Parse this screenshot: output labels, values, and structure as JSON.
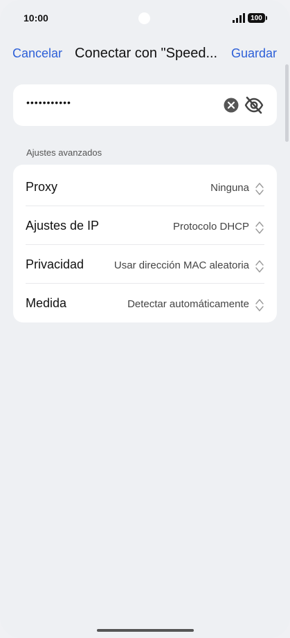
{
  "status_bar": {
    "time": "10:00",
    "battery": "100"
  },
  "header": {
    "cancel_label": "Cancelar",
    "title": "Conectar con \"Speed...",
    "save_label": "Guardar"
  },
  "password": {
    "value": "•••••••••••"
  },
  "advanced": {
    "section_title": "Ajustes avanzados",
    "rows": [
      {
        "label": "Proxy",
        "value": "Ninguna"
      },
      {
        "label": "Ajustes de IP",
        "value": "Protocolo DHCP"
      },
      {
        "label": "Privacidad",
        "value": "Usar dirección MAC aleatoria"
      },
      {
        "label": "Medida",
        "value": "Detectar automáticamente"
      }
    ]
  },
  "colors": {
    "accent": "#2c5fd8",
    "background": "#eef0f3",
    "card": "#ffffff"
  }
}
